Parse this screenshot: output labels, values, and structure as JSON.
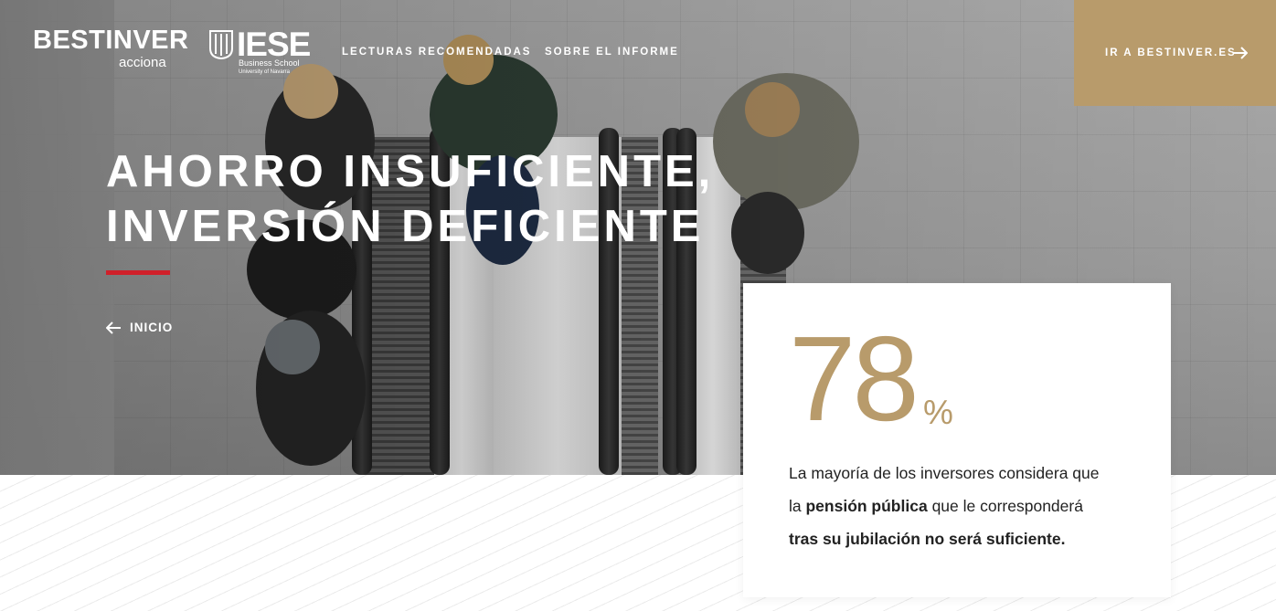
{
  "header": {
    "logo_bestinver": "BESTINVER",
    "logo_acciona": "acciona",
    "logo_iese": "IESE",
    "logo_iese_sub": "Business School",
    "logo_iese_sub2": "University of Navarra",
    "nav": [
      {
        "label": "LECTURAS RECOMENDADAS"
      },
      {
        "label": "SOBRE EL INFORME"
      }
    ],
    "cta_label": "IR A BESTINVER.ES",
    "cta_color": "#b89b6b"
  },
  "hero": {
    "title_line1": "AHORRO INSUFICIENTE,",
    "title_line2": "INVERSIÓN DEFICIENTE",
    "accent_color": "#d0202a",
    "back_label": "INICIO"
  },
  "stat": {
    "number": "78",
    "unit": "%",
    "text_1": "La mayoría de los inversores considera que la ",
    "text_bold_1": "pensión pública",
    "text_2": " que le corresponderá ",
    "text_bold_2": "tras su jubilación no será suficiente.",
    "number_color": "#b89b6b"
  },
  "icons": {
    "cta_arrow": "arrow-right-icon",
    "back_arrow": "arrow-left-icon",
    "iese_mark": "iese-shield-icon"
  }
}
